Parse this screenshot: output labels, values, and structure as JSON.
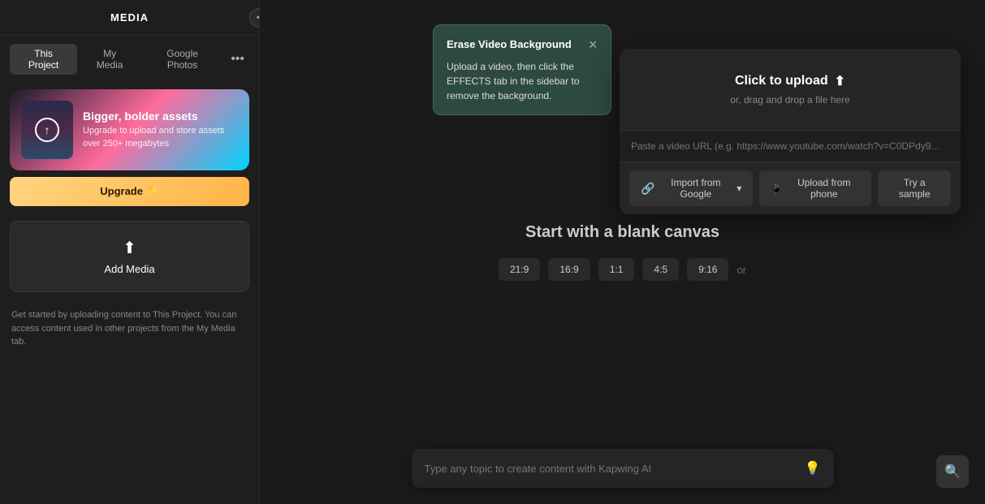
{
  "sidebar": {
    "title": "MEDIA",
    "tabs": [
      {
        "label": "This Project",
        "active": true
      },
      {
        "label": "My Media",
        "active": false
      },
      {
        "label": "Google Photos",
        "active": false
      }
    ],
    "upgrade_card": {
      "title": "Bigger, bolder assets",
      "description": "Upgrade to upload and store assets over 250+ megabytes",
      "upgrade_label": "Upgrade ✨"
    },
    "add_media_label": "Add Media",
    "info_text": "Get started by uploading content to This Project. You can access content used in other projects from the My Media tab."
  },
  "tooltip": {
    "title": "Erase Video Background",
    "body": "Upload a video, then click the EFFECTS tab in the sidebar to remove the background."
  },
  "main": {
    "blank_canvas": "Start with a blank canvas",
    "or_label": "or",
    "aspect_ratios": [
      "21:9",
      "16:9",
      "1:1",
      "4:5",
      "9:16"
    ]
  },
  "upload_panel": {
    "click_to_upload": "Click to upload",
    "drag_drop": "or, drag and drop a file here",
    "url_placeholder": "Paste a video URL (e.g. https://www.youtube.com/watch?v=C0DPdy9...",
    "import_google_label": "Import from Google",
    "upload_phone_label": "Upload from phone",
    "try_sample_label": "Try a sample"
  },
  "ai_bar": {
    "placeholder": "Type any topic to create content with Kapwing AI"
  },
  "icons": {
    "collapse": "◀",
    "more": "•••",
    "upload_arrow": "↑",
    "add_media_arrow": "↑",
    "upload_icon": "⬆",
    "chevron_down": "▾",
    "phone": "📱",
    "bulb": "💡",
    "search": "🔍",
    "close": "✕"
  }
}
